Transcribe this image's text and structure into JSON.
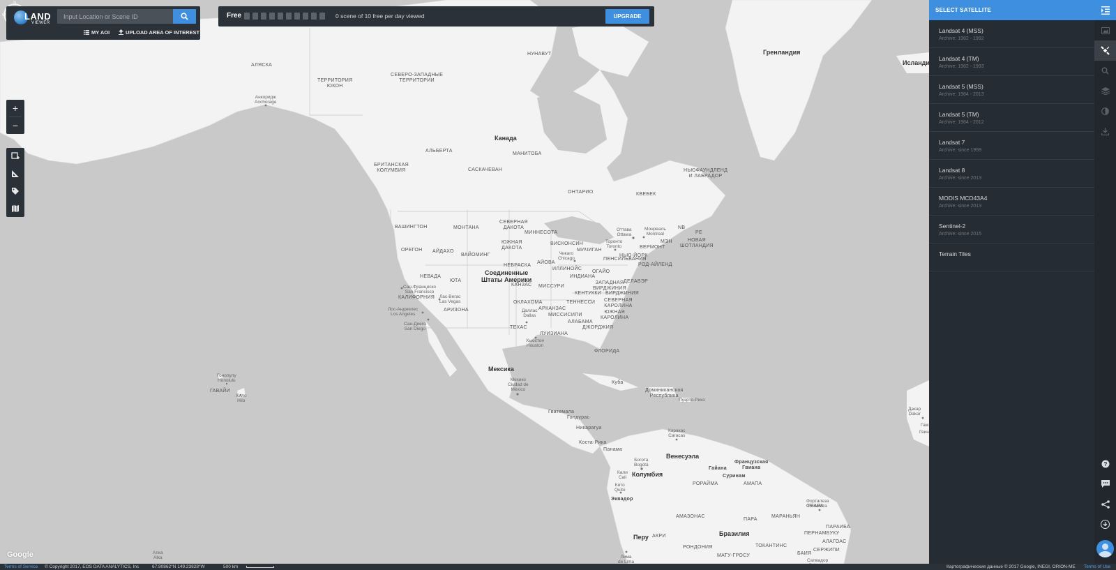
{
  "search": {
    "logo_line1": "LAND",
    "logo_line2": "VIEWER",
    "placeholder": "Input Location or Scene ID",
    "my_aoi": "MY AOI",
    "upload_aoi": "UPLOAD AREA OF INTEREST"
  },
  "top_bar": {
    "plan": "Free",
    "quota_total": 10,
    "quota_used": 0,
    "quota_text": "0 scene of 10 free per day viewed",
    "upgrade": "UPGRADE"
  },
  "map_tools": {
    "zoom_in": "+",
    "zoom_out": "−"
  },
  "satellite_panel": {
    "title": "SELECT SATELLITE",
    "items": [
      {
        "name": "Landsat 4 (MSS)",
        "archive": "Archive: 1982 - 1992"
      },
      {
        "name": "Landsat 4 (TM)",
        "archive": "Archive: 1982 - 1993"
      },
      {
        "name": "Landsat 5 (MSS)",
        "archive": "Archive: 1984 - 2013"
      },
      {
        "name": "Landsat 5 (TM)",
        "archive": "Archive: 1984 - 2012"
      },
      {
        "name": "Landsat 7",
        "archive": "Archive: since 1999"
      },
      {
        "name": "Landsat 8",
        "archive": "Archive: since 2013"
      },
      {
        "name": "MODIS MCD43A4",
        "archive": "Archive: since 2013"
      },
      {
        "name": "Sentinel-2",
        "archive": "Archive: since 2015"
      },
      {
        "name": "Terrain Tiles",
        "archive": ""
      }
    ]
  },
  "map": {
    "labels": {
      "alaska": "АЛЯСКА",
      "yukon": "ТЕРРИТОРИЯ\nЮКОН",
      "nwt": "СЕВЕРО-ЗАПАДНЫЕ\nТЕРРИТОРИИ",
      "nunavut": "НУНАВУТ",
      "greenland": "Гренландия",
      "iceland": "Исланди",
      "anchorage": "Анкоридж\nAnchorage",
      "canada": "Канада",
      "alberta": "АЛЬБЕРТА",
      "manitoba": "МАНИТОБА",
      "bc": "БРИТАНСКАЯ\nКОЛУМБИЯ",
      "saskatchewan": "САСКАЧЕВАН",
      "ontario": "ОНТАРИО",
      "quebec": "КВЕБЕК",
      "newfoundland": "НЬЮФАУНДЛЕНД\nИ ЛАБРАДОР",
      "washington": "ВАШИНГТОН",
      "montana": "МОНТАНА",
      "north_dakota": "СЕВЕРНАЯ\nДАКОТА",
      "minnesota": "МИННЕСОТА",
      "oregon": "ОРЕГОН",
      "idaho": "АЙДАХО",
      "wyoming": "ВАЙОМИНГ",
      "south_dakota": "ЮЖНАЯ\nДАКОТА",
      "wisconsin": "ВИСКОНСИН",
      "michigan": "МИЧИГАН",
      "ottawa": "Оттава\nOttawa",
      "montreal": "Монреаль\nMontreal",
      "toronto": "Торонто\nToronto",
      "new_york": "НЬЮ-ЙОРК",
      "maine": "МЭН",
      "vermont": "ВЕРМОНТ",
      "nova_scotia": "НОВАЯ\nШОТЛАНДИЯ",
      "nb": "NB",
      "pe": "PE",
      "nebraska": "НЕБРАСКА",
      "iowa": "АЙОВА",
      "illinois": "ИЛЛИНОЙС",
      "chicago": "Чикаго\nChicago",
      "indiana": "ИНДИАНА",
      "ohio": "ОГАЙО",
      "pennsylvania": "ПЕНСИЛЬВАНИЯ",
      "rhode_island": "РОД-АЙЛЕНД",
      "delaware": "ДЕЛАВЭР",
      "nevada": "НЕВАДА",
      "utah": "ЮТА",
      "usa": "Соединенные\nШтаты Америки",
      "kansas": "КАНЗАС",
      "missouri": "МИССУРИ",
      "west_virginia": "ЗАПАДНАЯ\nВИРДЖИНИЯ",
      "kentucky": "КЕНТУККИ",
      "virginia": "ВИРДЖИНИЯ",
      "san_francisco": "Сан-Франциско\nSan Francisco",
      "california": "КАЛИФОРНИЯ",
      "las_vegas": "Лас-Вегас\nLas Vegas",
      "arizona": "АРИЗОНА",
      "los_angeles": "Лос-Анджелес\nLos Angeles",
      "san_diego": "Сан-Диего\nSan Diego",
      "oklahoma": "ОКЛАХОМА",
      "arkansas": "АРКАНЗАС",
      "tennessee": "ТЕННЕССИ",
      "north_carolina": "СЕВЕРНАЯ\nКАРОЛИНА",
      "south_carolina": "ЮЖНАЯ\nКАРОЛИНА",
      "dallas": "Даллас\nDallas",
      "mississippi": "МИССИСИПИ",
      "alabama": "АЛАБАМА",
      "georgia": "ДЖОРДЖИЯ",
      "texas": "ТЕХАС",
      "louisiana": "ЛУИЗИАНА",
      "houston": "Хьюстон\nHouston",
      "florida": "ФЛОРИДА",
      "honolulu": "Гонолулу\nHonolulu",
      "hawaii": "ГАВАЙИ",
      "hilo": "Хило\nHilo",
      "mexico": "Мексика",
      "mexico_city": "Мехико\nCiudad de\nMéxico",
      "cuba": "Куба",
      "dominican": "Доминиканская\nРеспублика",
      "puerto_rico": "Пуэрто-Рико",
      "guatemala": "Гватемала",
      "honduras": "Гондурас",
      "nicaragua": "Никарагуа",
      "costa_rica": "Коста-Рика",
      "panama": "Панама",
      "caracas": "Каракас\nCaracas",
      "venezuela": "Венесуэла",
      "bogota": "Богота\nBogotá",
      "colombia": "Колумбия",
      "cali": "Кали\nCali",
      "quito": "Кито\nQuito",
      "ecuador": "Эквадор",
      "guyana": "Гайана",
      "suriname": "Суринам",
      "french_guiana": "Французская\nГвиана",
      "roraima": "РОРАЙМА",
      "amapa": "АМАПА",
      "amazonas": "АМАЗОНАС",
      "para": "ПАРА",
      "maranhao": "МАРАНЬЯН",
      "ceara": "СЕАРА",
      "fortaleza": "Форталеза\nFortaleza",
      "paraiba": "ПАРАИБА",
      "pernambuco": "ПЕРНАМБУКУ",
      "alagoas": "АЛАГОАС",
      "brazil": "Бразилия",
      "peru": "Перу",
      "acre": "АКРИ",
      "rondonia": "РОНДОНИЯ",
      "tocantins": "ТОКАНТИНС",
      "bahia": "БАИЯ",
      "sergipe": "СЕРЖИПИ",
      "salvador": "Салвадор\nSalvador",
      "mato_grosso": "МАТУ-ГРОСУ",
      "lima": "Лима\nde Lima",
      "dakar": "Дакар\nDakar",
      "gambia": "Гам",
      "guinea": "Гвин",
      "alka": "Алка\nAlka"
    }
  },
  "status_bar": {
    "terms_of_service": "Terms of Service",
    "copyright": "© Copyright 2017, EOS DATA ANALYTICS, Inc",
    "coordinates": "67.90862°N 149.23828°W",
    "scale": "500 km",
    "map_data": "Картографические данные © 2017 Google, INEGI, ORION-ME",
    "terms_of_use": "Terms of Use"
  },
  "google_logo": "Google",
  "colors": {
    "accent": "#3f8fe0",
    "panel_bg": "#2b3138",
    "sidebar_bg": "#262c33",
    "land": "#f3f3f3",
    "water": "#c9c9c9"
  }
}
